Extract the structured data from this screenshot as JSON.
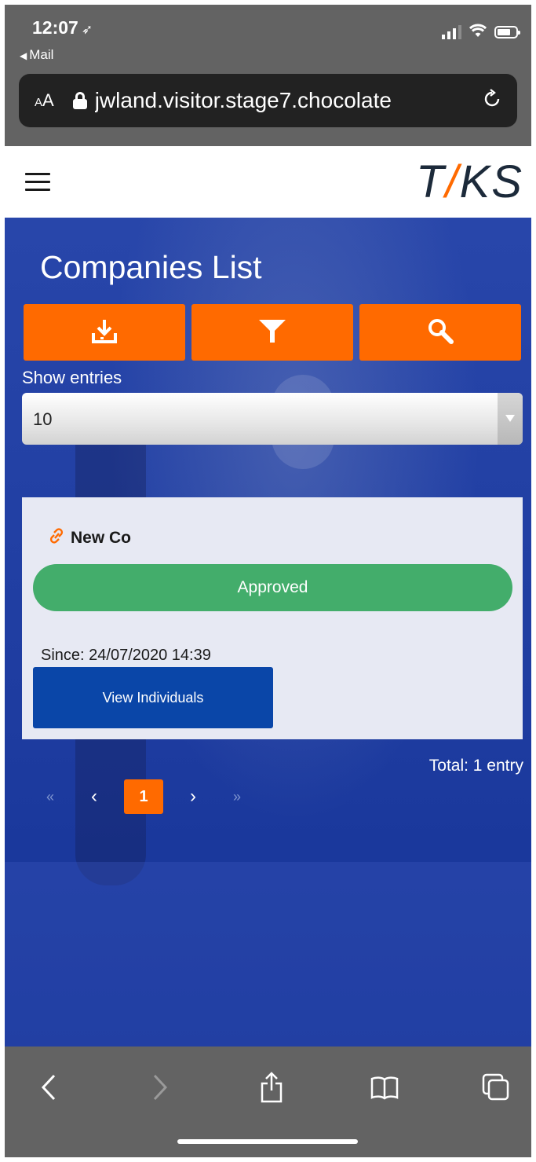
{
  "status_bar": {
    "time": "12:07",
    "back_app": "Mail"
  },
  "browser": {
    "text_size_label_small": "A",
    "text_size_label": "A",
    "url": "jwland.visitor.stage7.chocolate"
  },
  "site": {
    "logo_left": "T",
    "logo_slash": "/",
    "logo_right": "KS"
  },
  "page": {
    "title": "Companies List",
    "actions": [
      {
        "icon": "download-icon"
      },
      {
        "icon": "filter-icon"
      },
      {
        "icon": "search-icon"
      }
    ],
    "show_entries_label": "Show entries",
    "show_entries_value": "10",
    "company": {
      "name": "New Co",
      "icon": "link-icon",
      "status": "Approved",
      "since": "Since: 24/07/2020 14:39",
      "view_button": "View Individuals"
    },
    "total": "Total: 1 entry",
    "pagination": {
      "first": "«",
      "prev": "‹",
      "current": "1",
      "next": "›",
      "last": "»"
    }
  },
  "colors": {
    "accent_orange": "#ff6a00",
    "primary_blue": "#1a3f9c",
    "button_blue": "#0a46a8",
    "approved_green": "#43ad6b"
  },
  "toolbar_icons": [
    "back-icon",
    "forward-icon",
    "share-icon",
    "bookmarks-icon",
    "tabs-icon"
  ]
}
